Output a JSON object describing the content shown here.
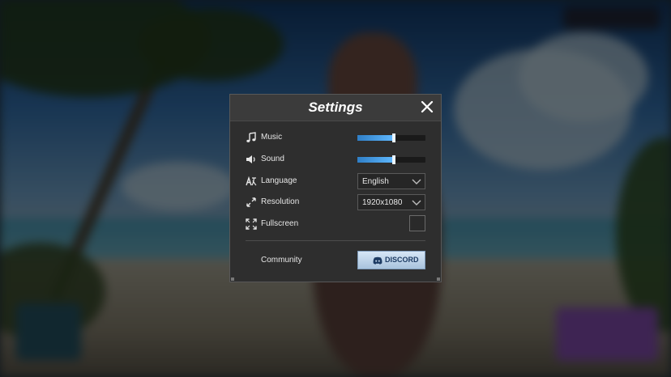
{
  "settings": {
    "title": "Settings",
    "music": {
      "label": "Music",
      "icon": "music-note-icon",
      "level": 0.54
    },
    "sound": {
      "label": "Sound",
      "icon": "speaker-icon",
      "level": 0.54
    },
    "language": {
      "label": "Language",
      "icon": "translate-icon",
      "value": "English"
    },
    "resolution": {
      "label": "Resolution",
      "icon": "expand-arrows-icon",
      "value": "1920x1080"
    },
    "fullscreen": {
      "label": "Fullscreen",
      "icon": "fullscreen-icon",
      "checked": false
    },
    "community": {
      "label": "Community",
      "button_label": "DISCORD",
      "button_icon": "discord-icon"
    }
  },
  "colors": {
    "panel_bg": "#2e2e2e",
    "slider_fill": "#5fb8ff",
    "discord_button": "#c1d7ec"
  }
}
